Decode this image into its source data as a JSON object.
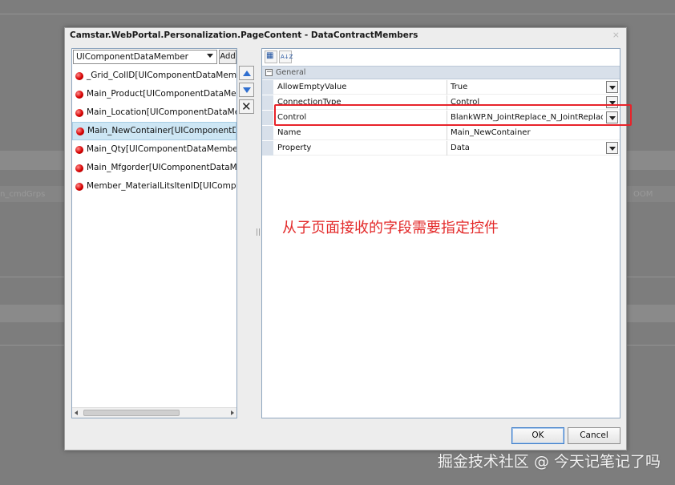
{
  "dialog": {
    "title": "Camstar.WebPortal.Personalization.PageContent - DataContractMembers",
    "close_glyph": "⨯"
  },
  "left_panel": {
    "type_select_value": "UIComponentDataMember",
    "add_label": "Add",
    "members": [
      "_Grid_ColID[UIComponentDataMember]",
      "Main_Product[UIComponentDataMember]",
      "Main_Location[UIComponentDataMember]",
      "Main_NewContainer[UIComponentDataMember]",
      "Main_Qty[UIComponentDataMember]",
      "Main_Mfgorder[UIComponentDataMember]",
      "Member_MaterialLitsItenID[UIComponentDataMember]"
    ],
    "selected_index": 3
  },
  "middle_buttons": {
    "move_up_icon": "arrow-up-icon",
    "move_down_icon": "arrow-down-icon",
    "delete_label": "✕"
  },
  "property_grid": {
    "toolbar": {
      "categorized_glyph": "▦",
      "alphabetical_glyph": "A↓Z"
    },
    "category": "General",
    "category_toggle": "−",
    "properties": [
      {
        "name": "AllowEmptyValue",
        "value": "True",
        "has_dropdown": true
      },
      {
        "name": "ConnectionType",
        "value": "Control",
        "has_dropdown": true
      },
      {
        "name": "Control",
        "value": "BlankWP.N_JointReplace_N_JointReplace",
        "has_dropdown": true
      },
      {
        "name": "Name",
        "value": "Main_NewContainer",
        "has_dropdown": false
      },
      {
        "name": "Property",
        "value": "Data",
        "has_dropdown": true
      }
    ]
  },
  "annotation_text": "从子页面接收的字段需要指定控件",
  "footer": {
    "ok_label": "OK",
    "cancel_label": "Cancel"
  },
  "watermark": "掘金技术社区 @ 今天记笔记了吗",
  "background_ghost_text": {
    "left": "n_cmdGrps",
    "right": "OOM"
  },
  "colors": {
    "highlight": "#e8232a",
    "annotation": "#e32a2a",
    "selection": "#cde6f4"
  }
}
